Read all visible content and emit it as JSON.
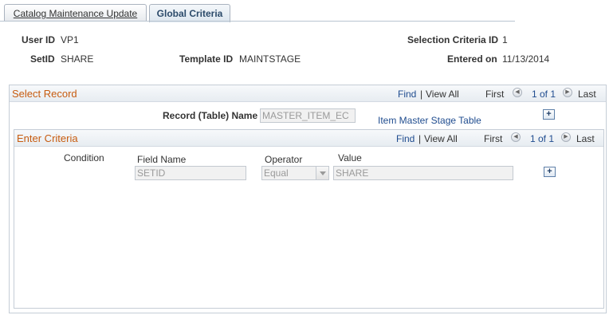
{
  "tabs": [
    {
      "label": "Catalog Maintenance Update",
      "active": false
    },
    {
      "label": "Global Criteria",
      "active": true
    }
  ],
  "header": {
    "user_id_label": "User ID",
    "user_id_value": "VP1",
    "selection_criteria_id_label": "Selection Criteria ID",
    "selection_criteria_id_value": "1",
    "setid_label": "SetID",
    "setid_value": "SHARE",
    "template_id_label": "Template ID",
    "template_id_value": "MAINTSTAGE",
    "entered_on_label": "Entered on",
    "entered_on_value": "11/13/2014"
  },
  "select_record": {
    "title": "Select Record",
    "find": "Find",
    "sep": "|",
    "view_all": "View All",
    "first": "First",
    "pager": "1 of 1",
    "last": "Last",
    "record_name_label": "Record (Table) Name",
    "record_name_value": "MASTER_ITEM_EC",
    "record_desc": "Item Master Stage Table",
    "add_label": "+"
  },
  "enter_criteria": {
    "title": "Enter Criteria",
    "find": "Find",
    "sep": "|",
    "view_all": "View All",
    "first": "First",
    "pager": "1 of 1",
    "last": "Last",
    "condition_label": "Condition",
    "field_name_label": "Field Name",
    "field_name_value": "SETID",
    "operator_label": "Operator",
    "operator_value": "Equal",
    "value_label": "Value",
    "value_value": "SHARE",
    "add_label": "+"
  },
  "colors": {
    "section_title": "#c75c10",
    "link": "#1f4c8f"
  }
}
